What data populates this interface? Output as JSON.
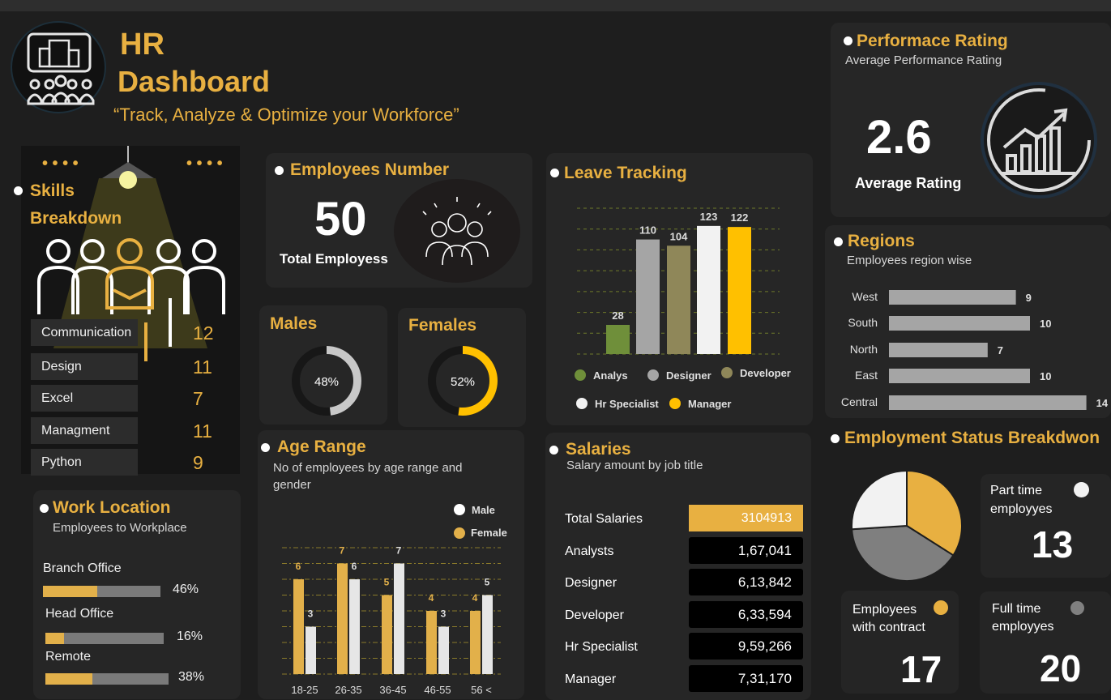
{
  "header": {
    "title_line1": "HR",
    "title_line2": "Dashboard",
    "tagline": "“Track, Analyze & Optimize your Workforce”"
  },
  "skills": {
    "title_line1": "Skills",
    "title_line2": "Breakdown",
    "items": [
      {
        "label": "Communication",
        "value": "12"
      },
      {
        "label": "Design",
        "value": "11"
      },
      {
        "label": "Excel",
        "value": "7"
      },
      {
        "label": "Managment",
        "value": "11"
      },
      {
        "label": "Python",
        "value": "9"
      }
    ]
  },
  "employees": {
    "title": "Employees Number",
    "value": "50",
    "caption": "Total Employess"
  },
  "males": {
    "title": "Males",
    "percent_label": "48%",
    "fraction": 0.48
  },
  "females": {
    "title": "Females",
    "percent_label": "52%",
    "fraction": 0.52
  },
  "leave": {
    "title": "Leave Tracking",
    "legend": [
      "Analys",
      "Designer",
      "Developer",
      "Hr Specialist",
      "Manager"
    ]
  },
  "performance": {
    "title": "Performace Rating",
    "subtitle": "Average Performance Rating",
    "value": "2.6",
    "caption": "Average Rating"
  },
  "regions": {
    "title": "Regions",
    "subtitle": "Employees region wise"
  },
  "employment": {
    "title": "Employment Status Breakdwon",
    "part_time_label_1": "Part time",
    "part_time_label_2": "employyes",
    "part_time_value": "13",
    "contract_label_1": "Employees",
    "contract_label_2": "with contract",
    "contract_value": "17",
    "full_time_label_1": "Full time",
    "full_time_label_2": "employyes",
    "full_time_value": "20"
  },
  "work_location": {
    "title": "Work Location",
    "subtitle": "Employees to Workplace",
    "items": [
      {
        "label": "Branch Office",
        "percent_label": "46%",
        "fraction": 0.46
      },
      {
        "label": "Head Office",
        "percent_label": "16%",
        "fraction": 0.16
      },
      {
        "label": "Remote",
        "percent_label": "38%",
        "fraction": 0.38
      }
    ]
  },
  "age": {
    "title": "Age Range",
    "subtitle_line1": "No of employees by age range and",
    "subtitle_line2": "gender",
    "legend_male": "Male",
    "legend_female": "Female"
  },
  "salaries": {
    "title": "Salaries",
    "subtitle": "Salary amount by job title",
    "rows": [
      {
        "label": "Total Salaries",
        "value": "3104913"
      },
      {
        "label": "Analysts",
        "value": "1,67,041"
      },
      {
        "label": "Designer",
        "value": "6,13,842"
      },
      {
        "label": "Developer",
        "value": "6,33,594"
      },
      {
        "label": "Hr Specialist",
        "value": "9,59,266"
      },
      {
        "label": "Manager",
        "value": "7,31,170"
      }
    ]
  },
  "colors": {
    "accent": "#e8b041",
    "analys": "#6f8f3a",
    "designer": "#a5a5a5",
    "developer": "#8f8759",
    "hr_specialist": "#f2f2f2",
    "manager": "#ffc000",
    "male_bar": "#e6e6e6",
    "female_bar": "#e2b04a"
  },
  "chart_data": [
    {
      "type": "bar",
      "title": "Leave Tracking",
      "categories": [
        "Analys",
        "Designer",
        "Developer",
        "Hr Specialist",
        "Manager"
      ],
      "values": [
        28,
        110,
        104,
        123,
        122
      ],
      "ylim": [
        0,
        140
      ]
    },
    {
      "type": "bar",
      "title": "Regions",
      "subtitle": "Employees region wise",
      "categories": [
        "West",
        "South",
        "North",
        "East",
        "Central"
      ],
      "values": [
        9,
        10,
        7,
        10,
        14
      ],
      "orientation": "horizontal"
    },
    {
      "type": "bar",
      "title": "Age Range",
      "categories": [
        "18-25",
        "26-35",
        "36-45",
        "46-55",
        "56 <"
      ],
      "series": [
        {
          "name": "Female",
          "values": [
            6,
            7,
            5,
            4,
            4
          ]
        },
        {
          "name": "Male",
          "values": [
            3,
            6,
            7,
            3,
            5
          ]
        }
      ],
      "ylim": [
        0,
        8
      ]
    },
    {
      "type": "pie",
      "title": "Employment Status Breakdwon",
      "categories": [
        "Employees with contract",
        "Full time employyes",
        "Part time employyes"
      ],
      "values": [
        17,
        20,
        13
      ]
    }
  ]
}
